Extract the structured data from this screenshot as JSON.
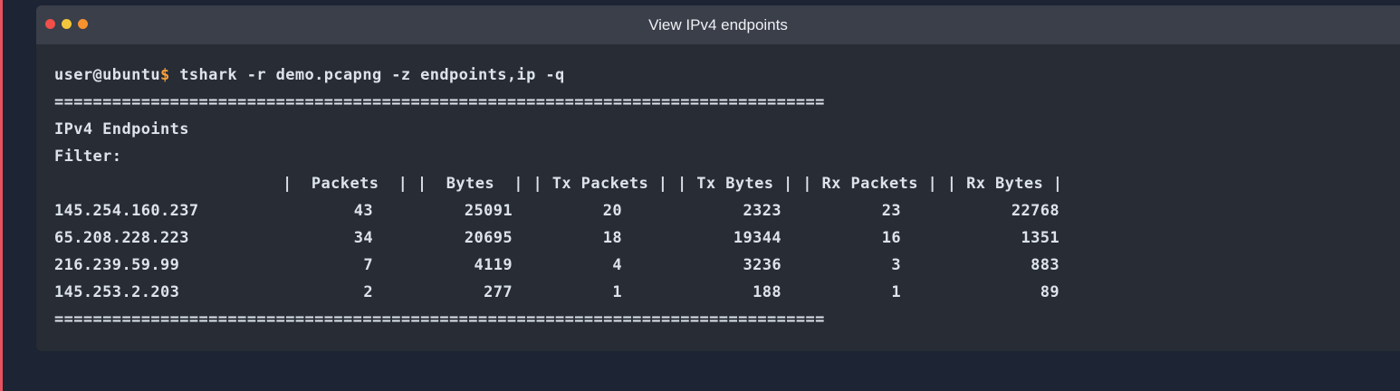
{
  "window": {
    "title": "View IPv4 endpoints"
  },
  "terminal": {
    "prompt_user": "user@ubuntu",
    "prompt_symbol": "$",
    "command": " tshark -r demo.pcapng -z endpoints,ip -q",
    "separator": "================================================================================",
    "heading": "IPv4 Endpoints",
    "filter_label": "Filter:",
    "header_line": "|  Packets  | |  Bytes  | | Tx Packets | | Tx Bytes | | Rx Packets | | Rx Bytes |",
    "rows": [
      {
        "ip": "145.254.160.237",
        "packets": "43",
        "bytes": "25091",
        "tx_packets": "20",
        "tx_bytes": "2323",
        "rx_packets": "23",
        "rx_bytes": "22768"
      },
      {
        "ip": "65.208.228.223",
        "packets": "34",
        "bytes": "20695",
        "tx_packets": "18",
        "tx_bytes": "19344",
        "rx_packets": "16",
        "rx_bytes": "1351"
      },
      {
        "ip": "216.239.59.99",
        "packets": "7",
        "bytes": "4119",
        "tx_packets": "4",
        "tx_bytes": "3236",
        "rx_packets": "3",
        "rx_bytes": "883"
      },
      {
        "ip": "145.253.2.203",
        "packets": "2",
        "bytes": "277",
        "tx_packets": "1",
        "tx_bytes": "188",
        "rx_packets": "1",
        "rx_bytes": "89"
      }
    ]
  },
  "colors": {
    "background": "#1d2433",
    "window": "#272c35",
    "titlebar": "#3a3f4a",
    "prompt_dollar": "#f7a13a",
    "close": "#f14f4a",
    "minimize": "#f3c73b",
    "maximize": "#f7922f"
  }
}
